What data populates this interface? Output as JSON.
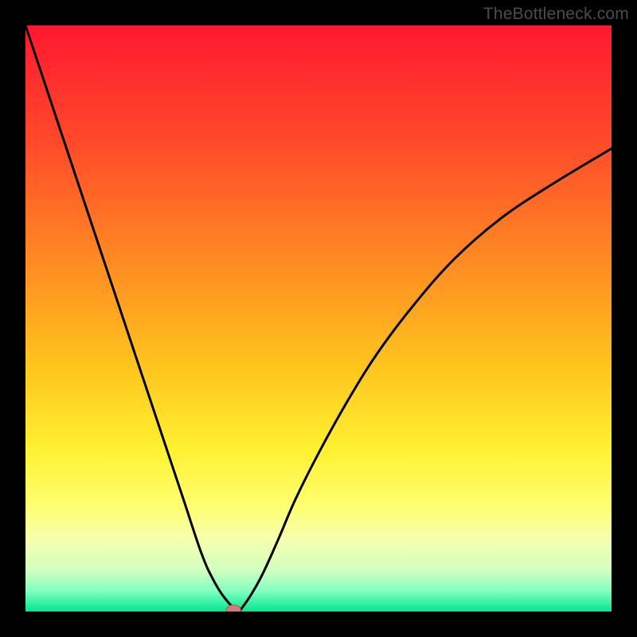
{
  "watermark": "TheBottleneck.com",
  "colors": {
    "frame": "#000000",
    "curve": "#000000",
    "dot_fill": "#d47a7a",
    "dot_stroke": "#b45a5a",
    "gradient_stops": [
      {
        "offset": 0.0,
        "color": "#ff1830"
      },
      {
        "offset": 0.2,
        "color": "#ff4a2a"
      },
      {
        "offset": 0.4,
        "color": "#ff8a22"
      },
      {
        "offset": 0.58,
        "color": "#ffc41e"
      },
      {
        "offset": 0.72,
        "color": "#fff030"
      },
      {
        "offset": 0.82,
        "color": "#ffff70"
      },
      {
        "offset": 0.88,
        "color": "#f4ffb0"
      },
      {
        "offset": 0.93,
        "color": "#d0ffc0"
      },
      {
        "offset": 0.965,
        "color": "#80ffc0"
      },
      {
        "offset": 1.0,
        "color": "#00e890"
      }
    ]
  },
  "chart_data": {
    "type": "line",
    "title": "",
    "xlabel": "",
    "ylabel": "",
    "xlim": [
      0,
      100
    ],
    "ylim": [
      0,
      100
    ],
    "grid": false,
    "legend": false,
    "series": [
      {
        "name": "bottleneck-curve",
        "x": [
          0,
          3,
          6,
          9,
          12,
          15,
          18,
          21,
          24,
          27,
          30,
          32,
          34,
          36,
          37,
          40,
          43,
          46,
          50,
          55,
          60,
          66,
          73,
          81,
          90,
          100
        ],
        "y": [
          100,
          91,
          82,
          73,
          64,
          55,
          46,
          37,
          28,
          19,
          10,
          5.5,
          2.3,
          0.3,
          0.7,
          5.5,
          12,
          19,
          27,
          36,
          44,
          52,
          60,
          67,
          73,
          79
        ]
      }
    ],
    "annotations": [
      {
        "type": "point",
        "name": "optimal-point",
        "x": 35.5,
        "y": 0.3
      }
    ]
  }
}
